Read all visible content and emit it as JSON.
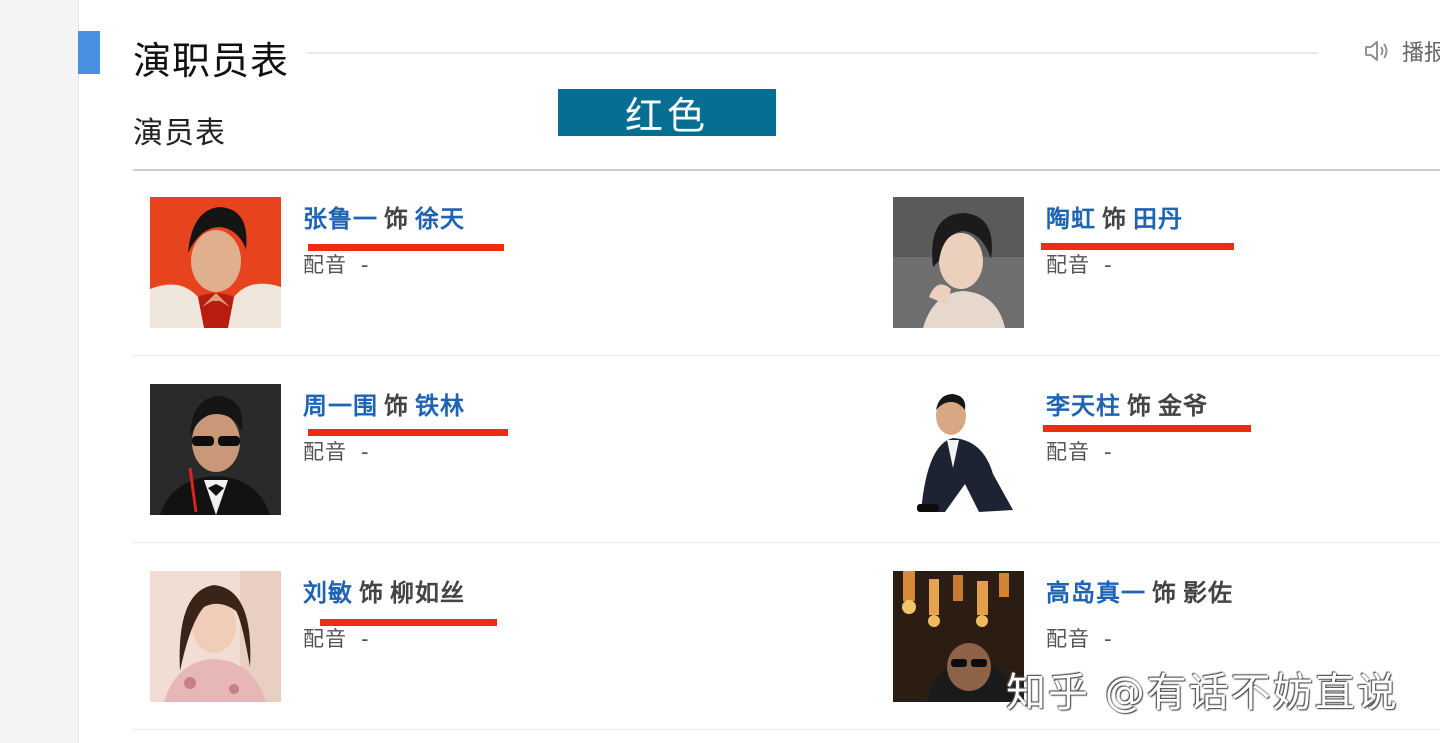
{
  "section": {
    "title": "演职员表",
    "broadcast_label": "播报"
  },
  "cast_header": {
    "title": "演员表"
  },
  "annotation": {
    "color_tag": "红色"
  },
  "cast": [
    {
      "actor": "张鲁一",
      "as_word": "饰",
      "role": "徐天",
      "dub_label": "配音",
      "dub_value": "-"
    },
    {
      "actor": "陶虹",
      "as_word": "饰",
      "role": "田丹",
      "dub_label": "配音",
      "dub_value": "-"
    },
    {
      "actor": "周一围",
      "as_word": "饰",
      "role": "铁林",
      "dub_label": "配音",
      "dub_value": "-"
    },
    {
      "actor": "李天柱",
      "as_word": "饰",
      "role": "金爷",
      "dub_label": "配音",
      "dub_value": "-"
    },
    {
      "actor": "刘敏",
      "as_word": "饰",
      "role": "柳如丝",
      "dub_label": "配音",
      "dub_value": "-"
    },
    {
      "actor": "高岛真一",
      "as_word": "饰",
      "role": "影佐",
      "dub_label": "配音",
      "dub_value": "-"
    }
  ],
  "watermark": {
    "text": "知乎 @有话不妨直说"
  },
  "colors": {
    "link_blue": "#1f64b4",
    "accent_bar": "#4a90e2",
    "annotation_bg": "#056e92",
    "underline_red": "#ef2b12"
  }
}
